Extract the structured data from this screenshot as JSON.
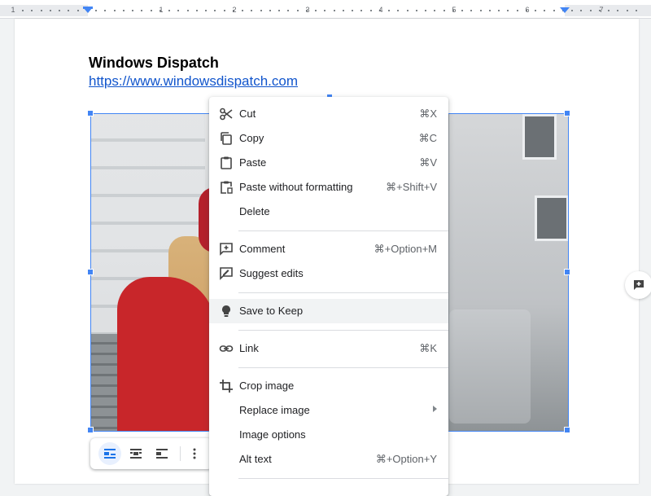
{
  "ruler": {
    "numbers": [
      "1",
      "1",
      "2",
      "3",
      "4",
      "5",
      "6",
      "7"
    ]
  },
  "document": {
    "title": "Windows Dispatch",
    "link": "https://www.windowsdispatch.com"
  },
  "context_menu": {
    "items": [
      {
        "label": "Cut",
        "shortcut": "⌘X",
        "icon": "scissors-icon"
      },
      {
        "label": "Copy",
        "shortcut": "⌘C",
        "icon": "copy-icon"
      },
      {
        "label": "Paste",
        "shortcut": "⌘V",
        "icon": "clipboard-icon"
      },
      {
        "label": "Paste without formatting",
        "shortcut": "⌘+Shift+V",
        "icon": "paste-plain-icon"
      },
      {
        "label": "Delete",
        "shortcut": ""
      },
      {
        "label": "Comment",
        "shortcut": "⌘+Option+M",
        "icon": "add-comment-icon"
      },
      {
        "label": "Suggest edits",
        "shortcut": "",
        "icon": "suggest-edit-icon"
      },
      {
        "label": "Save to Keep",
        "shortcut": "",
        "icon": "lightbulb-icon"
      },
      {
        "label": "Link",
        "shortcut": "⌘K",
        "icon": "link-icon"
      },
      {
        "label": "Crop image",
        "shortcut": "",
        "icon": "crop-icon"
      },
      {
        "label": "Replace image",
        "shortcut": "",
        "submenu": true
      },
      {
        "label": "Image options",
        "shortcut": ""
      },
      {
        "label": "Alt text",
        "shortcut": "⌘+Option+Y"
      }
    ]
  },
  "colors": {
    "accent": "#4285f4",
    "link": "#1155cc",
    "hover": "#f1f3f4"
  }
}
